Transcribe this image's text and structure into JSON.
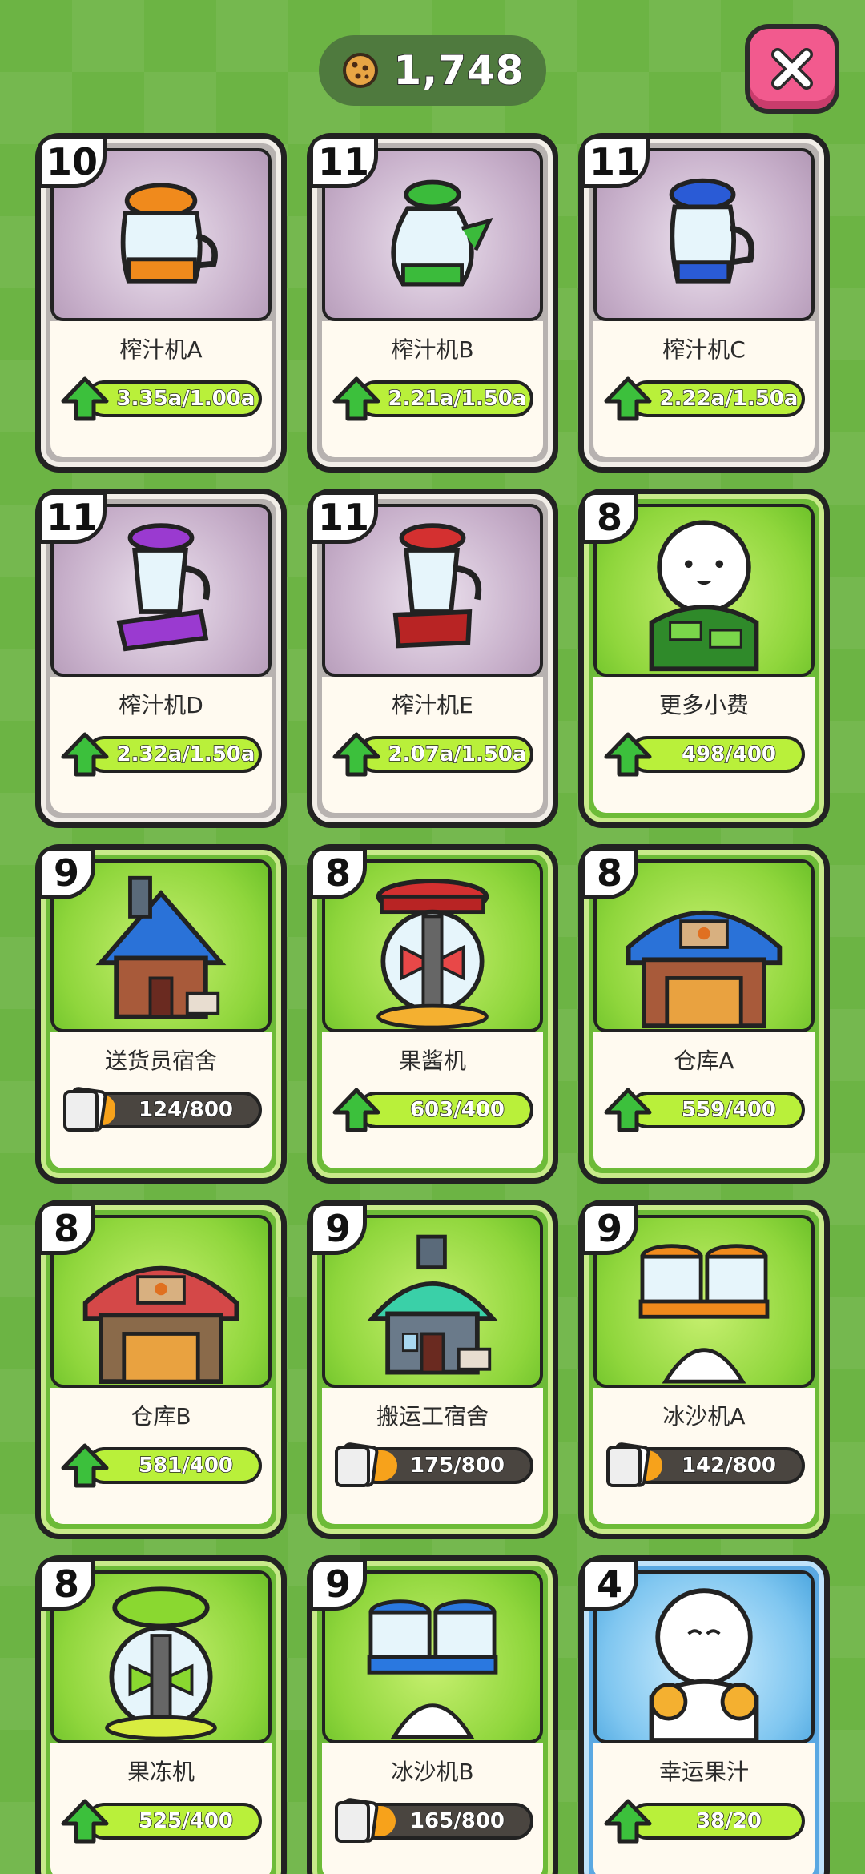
{
  "header": {
    "currency_value": "1,748",
    "currency_icon": "cookie-icon"
  },
  "close_button": {
    "icon": "close-icon"
  },
  "colors": {
    "background": "#6cb444",
    "grey_card": "#b7b2b0",
    "green_card": "#6dbb38",
    "blue_card": "#5aa8e2",
    "progress_lime": "#b9f03a",
    "progress_orange": "#f7a21b",
    "close_button": "#f25a8e"
  },
  "cards": [
    {
      "level": "10",
      "name": "榨汁机A",
      "progress": "3.35a/1.00a",
      "fill": 1.0,
      "style": "grey",
      "bar_icon": "upgrade-arrow-icon",
      "bar_color": "lime",
      "image": "juicer-orange-icon"
    },
    {
      "level": "11",
      "name": "榨汁机B",
      "progress": "2.21a/1.50a",
      "fill": 1.0,
      "style": "grey",
      "bar_icon": "upgrade-arrow-icon",
      "bar_color": "lime",
      "image": "juicer-green-icon"
    },
    {
      "level": "11",
      "name": "榨汁机C",
      "progress": "2.22a/1.50a",
      "fill": 1.0,
      "style": "grey",
      "bar_icon": "upgrade-arrow-icon",
      "bar_color": "lime",
      "image": "juicer-blue-icon"
    },
    {
      "level": "11",
      "name": "榨汁机D",
      "progress": "2.32a/1.50a",
      "fill": 1.0,
      "style": "grey",
      "bar_icon": "upgrade-arrow-icon",
      "bar_color": "lime",
      "image": "blender-purple-icon"
    },
    {
      "level": "11",
      "name": "榨汁机E",
      "progress": "2.07a/1.50a",
      "fill": 1.0,
      "style": "grey",
      "bar_icon": "upgrade-arrow-icon",
      "bar_color": "lime",
      "image": "blender-red-icon"
    },
    {
      "level": "8",
      "name": "更多小费",
      "progress": "498/400",
      "fill": 1.0,
      "style": "green",
      "bar_icon": "upgrade-arrow-icon",
      "bar_color": "lime",
      "image": "money-character-icon"
    },
    {
      "level": "9",
      "name": "送货员宿舍",
      "progress": "124/800",
      "fill": 0.155,
      "style": "green",
      "bar_icon": "card-stack-icon",
      "bar_color": "orange",
      "image": "blue-house-icon"
    },
    {
      "level": "8",
      "name": "果酱机",
      "progress": "603/400",
      "fill": 1.0,
      "style": "green",
      "bar_icon": "upgrade-arrow-icon",
      "bar_color": "lime",
      "image": "jam-machine-icon"
    },
    {
      "level": "8",
      "name": "仓库A",
      "progress": "559/400",
      "fill": 1.0,
      "style": "green",
      "bar_icon": "upgrade-arrow-icon",
      "bar_color": "lime",
      "image": "blue-warehouse-icon"
    },
    {
      "level": "8",
      "name": "仓库B",
      "progress": "581/400",
      "fill": 1.0,
      "style": "green",
      "bar_icon": "upgrade-arrow-icon",
      "bar_color": "lime",
      "image": "red-warehouse-icon"
    },
    {
      "level": "9",
      "name": "搬运工宿舍",
      "progress": "175/800",
      "fill": 0.219,
      "style": "green",
      "bar_icon": "card-stack-icon",
      "bar_color": "orange",
      "image": "teal-house-icon"
    },
    {
      "level": "9",
      "name": "冰沙机A",
      "progress": "142/800",
      "fill": 0.178,
      "style": "green",
      "bar_icon": "card-stack-icon",
      "bar_color": "orange",
      "image": "smoothie-orange-icon"
    },
    {
      "level": "8",
      "name": "果冻机",
      "progress": "525/400",
      "fill": 1.0,
      "style": "green",
      "bar_icon": "upgrade-arrow-icon",
      "bar_color": "lime",
      "image": "jelly-machine-icon"
    },
    {
      "level": "9",
      "name": "冰沙机B",
      "progress": "165/800",
      "fill": 0.206,
      "style": "green",
      "bar_icon": "card-stack-icon",
      "bar_color": "orange",
      "image": "smoothie-blue-icon"
    },
    {
      "level": "4",
      "name": "幸运果汁",
      "progress": "38/20",
      "fill": 1.0,
      "style": "blue",
      "bar_icon": "upgrade-arrow-icon",
      "bar_color": "lime",
      "image": "lucky-juice-character-icon"
    }
  ]
}
